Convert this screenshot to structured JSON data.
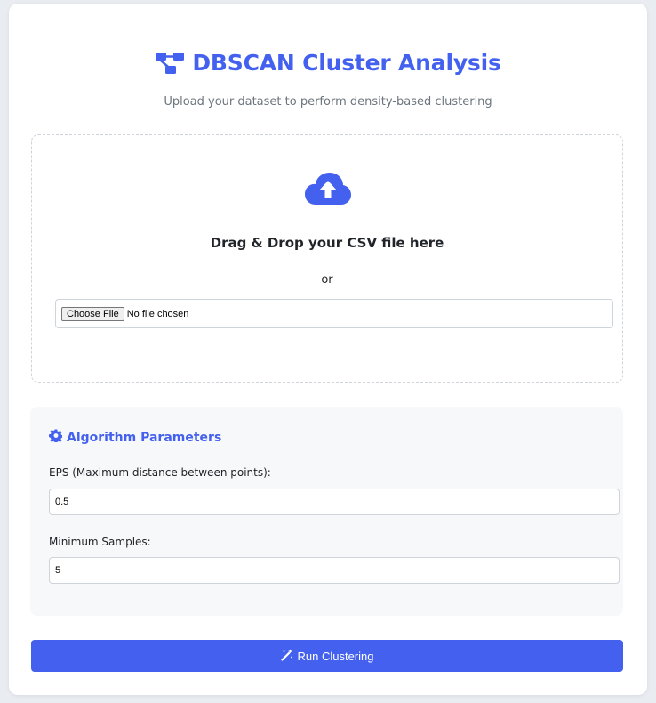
{
  "header": {
    "title": "DBSCAN Cluster Analysis",
    "subtitle": "Upload your dataset to perform density-based clustering",
    "icon": "project-diagram-icon"
  },
  "upload": {
    "icon": "cloud-upload-icon",
    "drop_text": "Drag & Drop your CSV file here",
    "or_text": "or",
    "choose_file_label": "Choose File",
    "file_status": "No file chosen"
  },
  "params": {
    "icon": "gear-icon",
    "heading": "Algorithm Parameters",
    "eps": {
      "label": "EPS (Maximum distance between points):",
      "value": "0.5"
    },
    "min_samples": {
      "label": "Minimum Samples:",
      "value": "5"
    }
  },
  "run": {
    "icon": "magic-wand-icon",
    "label": "Run Clustering"
  },
  "colors": {
    "accent": "#4361ee",
    "text_muted": "#6c757d",
    "panel_bg": "#f7f8fa"
  }
}
